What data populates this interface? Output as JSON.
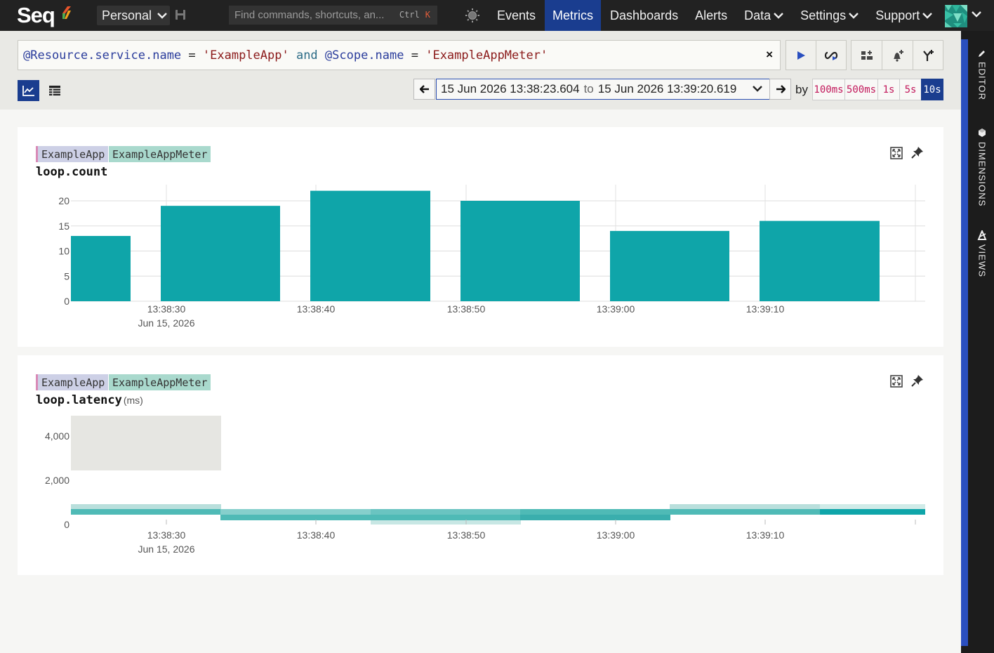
{
  "app": {
    "logo": "Seq"
  },
  "topbar": {
    "workspace": "Personal",
    "command_placeholder": "Find commands, shortcuts, an...",
    "command_shortcut_mod": "Ctrl",
    "command_shortcut_key": "K",
    "nav": [
      {
        "label": "Events",
        "active": false,
        "dropdown": false
      },
      {
        "label": "Metrics",
        "active": true,
        "dropdown": false
      },
      {
        "label": "Dashboards",
        "active": false,
        "dropdown": false
      },
      {
        "label": "Alerts",
        "active": false,
        "dropdown": false
      },
      {
        "label": "Data",
        "active": false,
        "dropdown": true
      },
      {
        "label": "Settings",
        "active": false,
        "dropdown": true
      },
      {
        "label": "Support",
        "active": false,
        "dropdown": true
      }
    ]
  },
  "sidepanel": {
    "editor": "EDITOR",
    "dimensions": "DIMENSIONS",
    "views": "VIEWS"
  },
  "query": {
    "prop1": "@Resource.service.name",
    "op1": " = ",
    "val1": "'ExampleApp'",
    "kw": " and ",
    "prop2": "@Scope.name",
    "op2": " = ",
    "val2": "'ExampleAppMeter'",
    "clear": "×"
  },
  "timerange": {
    "from": "15 Jun 2026 13:38:23.604",
    "to_word": "to",
    "to": "15 Jun 2026 13:39:20.619",
    "by": "by",
    "granularities": [
      "100ms",
      "500ms",
      "1s",
      "5s",
      "10s"
    ],
    "selected_granularity": "10s"
  },
  "charts": [
    {
      "resource": "ExampleApp",
      "scope": "ExampleAppMeter",
      "name": "loop.count",
      "unit": "",
      "date_label": "Jun 15, 2026"
    },
    {
      "resource": "ExampleApp",
      "scope": "ExampleAppMeter",
      "name": "loop.latency",
      "unit": "(ms)",
      "date_label": "Jun 15, 2026"
    }
  ],
  "chart_data": [
    {
      "type": "bar",
      "title": "loop.count",
      "x_ticks": [
        "13:38:30",
        "13:38:40",
        "13:38:50",
        "13:39:00",
        "13:39:10"
      ],
      "y_ticks": [
        0,
        5,
        10,
        15,
        20
      ],
      "ylim": [
        0,
        22
      ],
      "series": [
        {
          "values": [
            13,
            19,
            22,
            20,
            14,
            16
          ],
          "bucket_start": [
            "13:38:23.604",
            "13:38:30",
            "13:38:40",
            "13:38:50",
            "13:39:00",
            "13:39:10"
          ]
        }
      ],
      "grid": true,
      "color": "#0fa5a9"
    },
    {
      "type": "heatmap",
      "title": "loop.latency",
      "unit": "ms",
      "x_ticks": [
        "13:38:30",
        "13:38:40",
        "13:38:50",
        "13:39:00",
        "13:39:10"
      ],
      "y_ticks": [
        "0",
        "2,000",
        "4,000"
      ],
      "ylim": [
        0,
        4800
      ],
      "note": "latency distribution per 10s bucket",
      "color": "#0fa5a9"
    }
  ]
}
